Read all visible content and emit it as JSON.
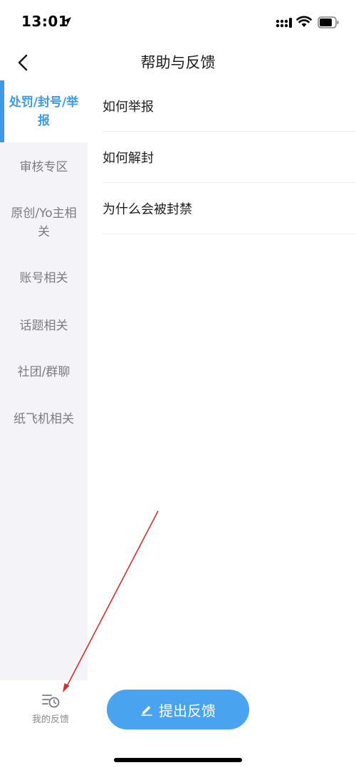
{
  "status_bar": {
    "time": "13:01"
  },
  "nav": {
    "title": "帮助与反馈",
    "back_icon": "chevron-left-icon"
  },
  "sidebar": {
    "items": [
      {
        "label": "处罚/封号/举报",
        "active": true
      },
      {
        "label": "审核专区",
        "active": false
      },
      {
        "label": "原创/Yo主相关",
        "active": false
      },
      {
        "label": "账号相关",
        "active": false
      },
      {
        "label": "话题相关",
        "active": false
      },
      {
        "label": "社团/群聊",
        "active": false
      },
      {
        "label": "纸飞机相关",
        "active": false
      }
    ]
  },
  "faq": {
    "items": [
      {
        "label": "如何举报"
      },
      {
        "label": "如何解封"
      },
      {
        "label": "为什么会被封禁"
      }
    ]
  },
  "footer": {
    "my_feedback_label": "我的反馈",
    "my_feedback_icon": "feedback-history-icon",
    "submit_label": "提出反馈",
    "submit_icon": "pencil-icon"
  },
  "colors": {
    "accent": "#3d9ae8",
    "button": "#4aa3ef",
    "sidebar_bg": "#f4f4f8",
    "annotation_arrow": "#d32f2f"
  }
}
